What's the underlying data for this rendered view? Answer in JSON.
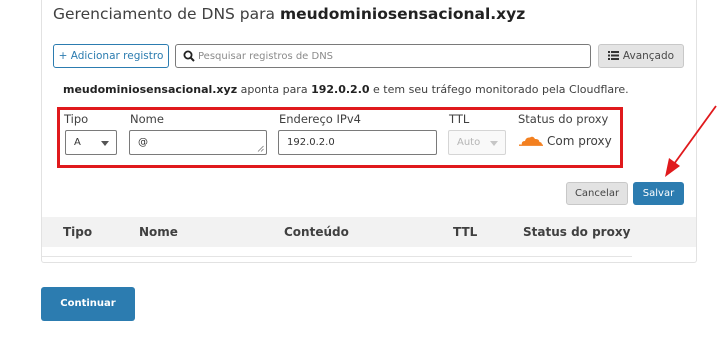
{
  "header": {
    "title_prefix": "Gerenciamento de DNS para ",
    "title_domain": "meudominiosensacional.xyz"
  },
  "toolbar": {
    "add_record_label": "+ Adicionar registro",
    "search_placeholder": "Pesquisar registros de DNS",
    "search_value": "",
    "advanced_label": "Avançado"
  },
  "info": {
    "domain": "meudominiosensacional.xyz",
    "text_1": " aponta para ",
    "ip": "192.0.2.0",
    "text_2": " e tem seu tráfego monitorado pela Cloudflare."
  },
  "form": {
    "type_label": "Tipo",
    "type_value": "A",
    "name_label": "Nome",
    "name_value": "@",
    "ipv4_label": "Endereço IPv4",
    "ipv4_value": "192.0.2.0",
    "ttl_label": "TTL",
    "ttl_value": "Auto",
    "proxy_label": "Status do proxy",
    "proxy_value": "Com proxy",
    "cancel_label": "Cancelar",
    "save_label": "Salvar"
  },
  "table": {
    "columns": [
      "Tipo",
      "Nome",
      "Conteúdo",
      "TTL",
      "Status do proxy"
    ]
  },
  "footer": {
    "continue_label": "Continuar"
  },
  "colors": {
    "primary": "#2c7cb0",
    "highlight": "#e0191c",
    "cloud": "#f38020"
  },
  "icons": [
    "search-icon",
    "advanced-filter-icon",
    "cloud-proxy-icon",
    "resize-handle-icon",
    "chevron-down-icon",
    "annotation-arrow"
  ]
}
